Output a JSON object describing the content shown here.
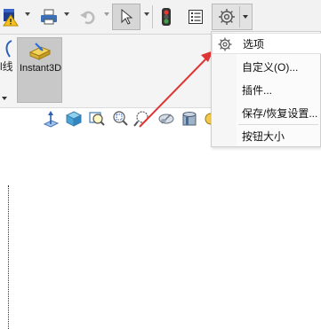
{
  "ribbon": {
    "left_partial_label": "l线",
    "instant3d_label": "Instant3D"
  },
  "toolbar": {
    "icons": [
      "warning-icon",
      "print-icon",
      "undo-icon",
      "select-cursor-icon",
      "traffic-light-icon",
      "list-icon",
      "gear-icon"
    ]
  },
  "menu": {
    "items": [
      {
        "label": "选项",
        "icon": "gear-icon"
      },
      {
        "label": "自定义(O)..."
      },
      {
        "label": "插件..."
      },
      {
        "label": "保存/恢复设置..."
      },
      {
        "label": "按钮大小"
      }
    ]
  },
  "annotation": {
    "arrow_color": "#e03535"
  },
  "colors": {
    "accent": "#1e6fd0",
    "menu_bg": "#fbfbfb"
  }
}
